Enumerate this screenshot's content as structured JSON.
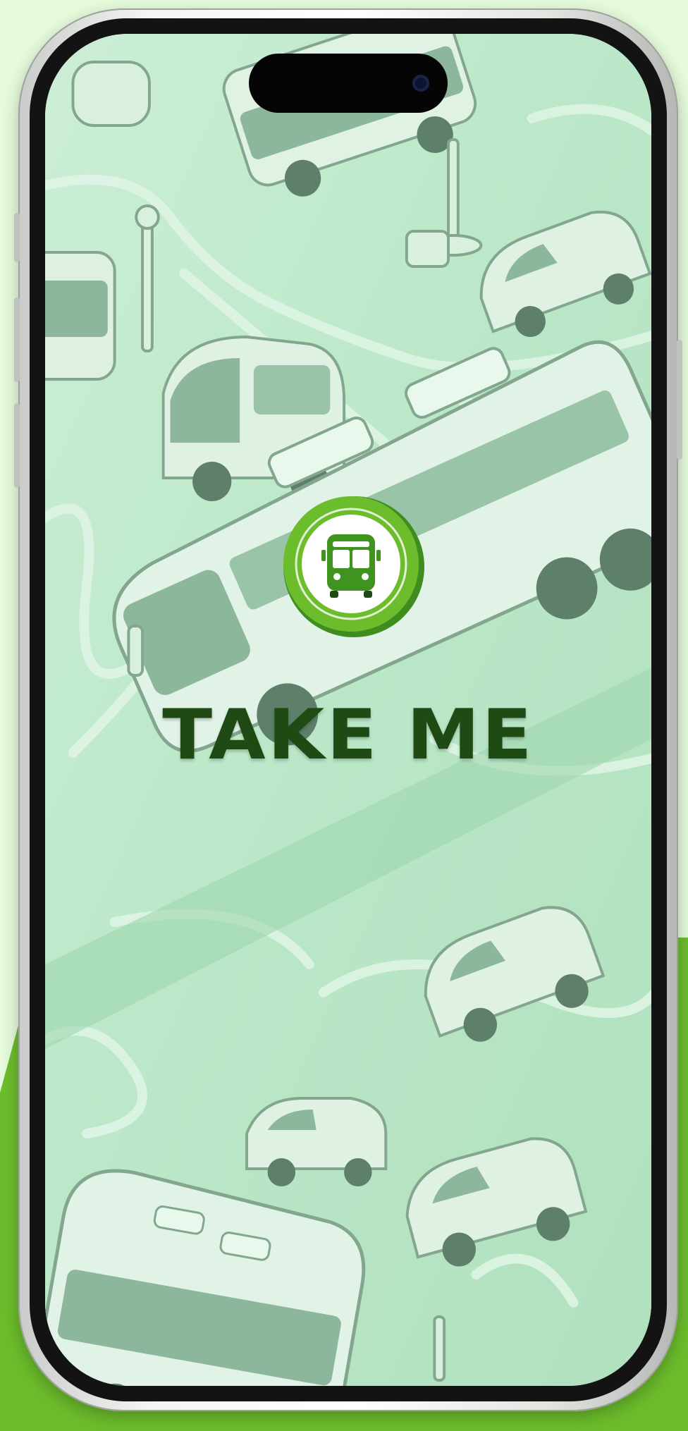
{
  "app": {
    "name": "TAKE ME",
    "screen": "splash"
  },
  "logo": {
    "icon": "bus-icon",
    "accent_color": "#6cbd2c",
    "dark_color": "#1f4a14"
  },
  "background": {
    "theme_color": "#c3ebcd",
    "page_color": "#e6fbdc"
  }
}
